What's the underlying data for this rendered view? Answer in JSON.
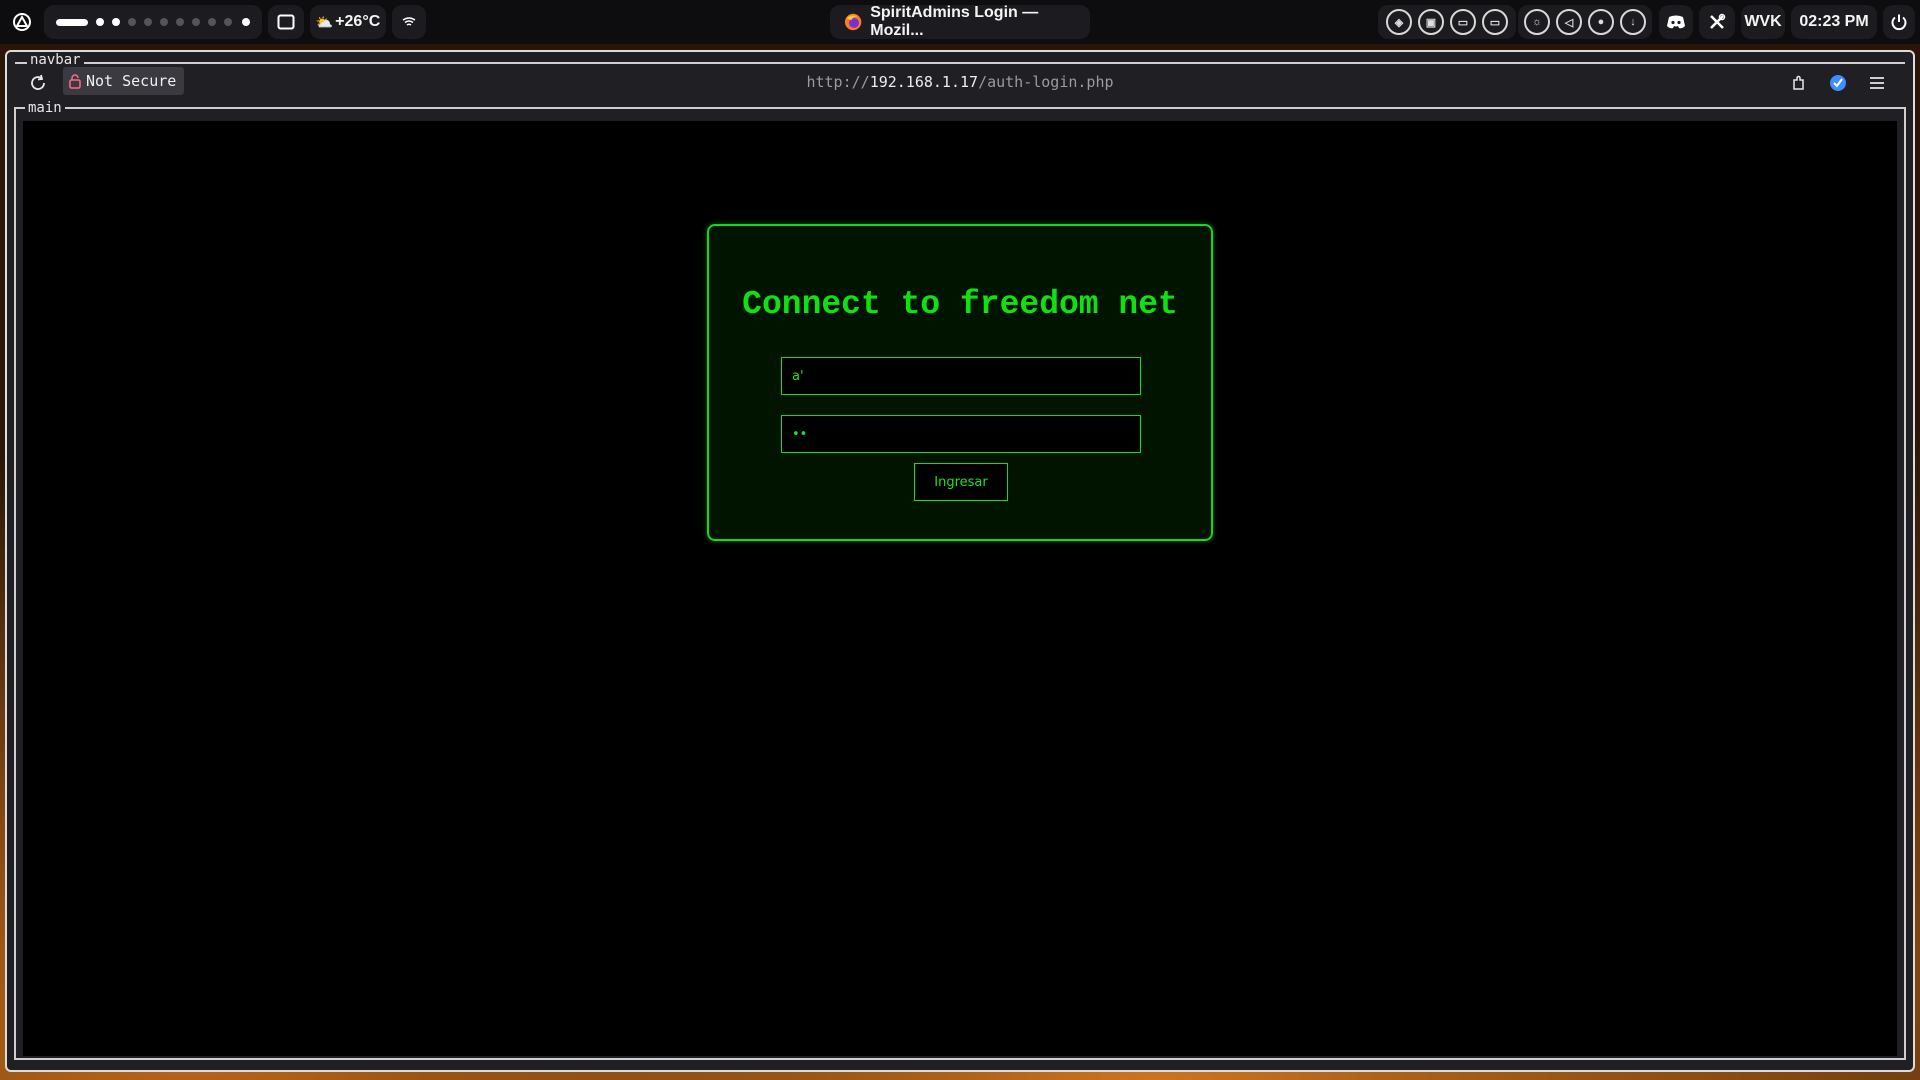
{
  "topbar": {
    "weather": "+26°C",
    "window_title": "SpiritAdmins Login — Mozil...",
    "keyboard_layout": "WVK",
    "clock": "02:23 PM",
    "workspaces": {
      "active": 1,
      "dots": [
        "on",
        "on",
        "off",
        "off",
        "off",
        "off",
        "off",
        "off",
        "off",
        "on"
      ]
    }
  },
  "browser": {
    "navbar_label": "navbar",
    "main_label": "main",
    "security_label": "Not Secure",
    "url_scheme": "http://",
    "url_host": "192.168.1.17",
    "url_path": "/auth-login.php"
  },
  "login": {
    "title": "Connect to freedom net",
    "username_value": "a'",
    "password_value": "..",
    "submit_label": "Ingresar"
  },
  "colors": {
    "accent_green": "#16d816",
    "card_bg": "#001400",
    "page_bg": "#000000"
  },
  "icons": [
    "launcher-icon",
    "window-icon",
    "wifi-icon",
    "firefox-icon",
    "cpu-icon",
    "memory-icon",
    "storage-icon",
    "temperature-icon",
    "brightness-icon",
    "volume-icon",
    "microphone-icon",
    "download-icon",
    "discord-icon",
    "tools-icon",
    "power-icon",
    "reload-icon",
    "lock-icon",
    "extensions-icon",
    "bitwarden-icon",
    "menu-icon"
  ]
}
